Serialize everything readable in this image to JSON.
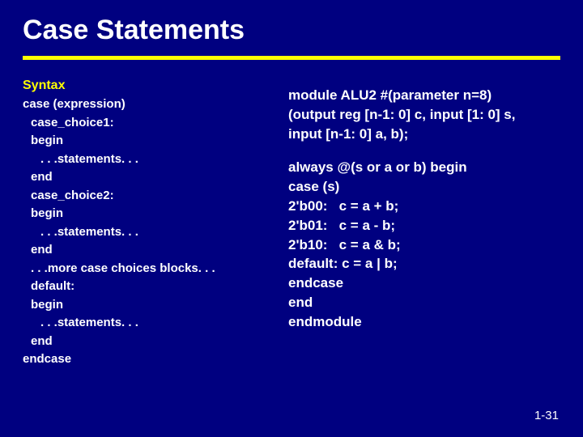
{
  "title": "Case Statements",
  "left": {
    "label": "Syntax",
    "l1": "case (expression)",
    "l2": "case_choice1:",
    "l3": "begin",
    "l4": ". . .statements. . .",
    "l5": "end",
    "l6": "case_choice2:",
    "l7": "begin",
    "l8": ". . .statements. . .",
    "l9": "end",
    "l10": ". . .more case choices blocks. . .",
    "l11": "default:",
    "l12": "begin",
    "l13": ". . .statements. . .",
    "l14": "end",
    "l15": "endcase"
  },
  "right": {
    "r1": "module ALU2 #(parameter n=8)",
    "r2": "(output reg [n-1: 0] c, input [1: 0] s,",
    "r3": "input [n-1: 0] a, b);",
    "r4": "always @(s or a or b) begin",
    "r5": "case (s)",
    "r6": "2'b00:   c = a + b;",
    "r7": "2'b01:   c = a - b;",
    "r8": "2'b10:   c = a & b;",
    "r9": "default: c = a | b;",
    "r10": "endcase",
    "r11": "end",
    "r12": "endmodule"
  },
  "page": "1-31"
}
